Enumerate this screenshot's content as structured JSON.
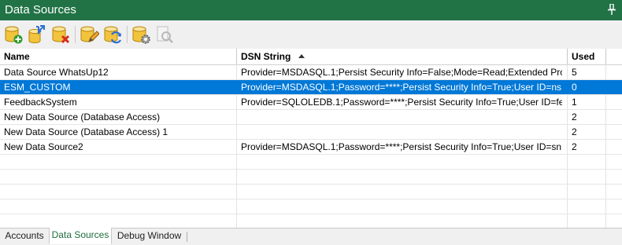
{
  "window": {
    "title": "Data Sources"
  },
  "toolbar": {
    "buttons": [
      {
        "icon": "add-database-icon"
      },
      {
        "icon": "import-database-icon"
      },
      {
        "icon": "delete-database-icon"
      },
      {
        "icon": "edit-database-icon"
      },
      {
        "icon": "refresh-database-icon"
      },
      {
        "icon": "configure-database-icon"
      },
      {
        "icon": "test-database-icon",
        "disabled": true
      }
    ]
  },
  "grid": {
    "columns": [
      {
        "label": "Name"
      },
      {
        "label": "DSN String",
        "sorted": "ascending"
      },
      {
        "label": "Used"
      }
    ],
    "rows": [
      {
        "name": "Data Source WhatsUp12",
        "dsn": "Provider=MSDASQL.1;Persist Security Info=False;Mode=Read;Extended Pro...",
        "used": "5",
        "selected": false
      },
      {
        "name": "ESM_CUSTOM",
        "dsn": "Provider=MSDASQL.1;Password=****;Persist Security Info=True;User ID=ns...",
        "used": "0",
        "selected": true
      },
      {
        "name": "FeedbackSystem",
        "dsn": "Provider=SQLOLEDB.1;Password=****;Persist Security Info=True;User ID=fe...",
        "used": "1",
        "selected": false
      },
      {
        "name": "New Data Source (Database Access)",
        "dsn": "",
        "used": "2",
        "selected": false
      },
      {
        "name": "New Data Source (Database Access) 1",
        "dsn": "",
        "used": "2",
        "selected": false
      },
      {
        "name": "New Data Source2",
        "dsn": "Provider=MSDASQL.1;Password=****;Persist Security Info=True;User ID=sn...",
        "used": "2",
        "selected": false
      }
    ]
  },
  "tabs": [
    {
      "label": "Accounts",
      "active": false
    },
    {
      "label": "Data Sources",
      "active": true
    },
    {
      "label": "Debug Window",
      "active": false
    }
  ],
  "colors": {
    "accent": "#217346",
    "selection": "#0078d7",
    "active_tab_text": "#1e6e3e"
  }
}
